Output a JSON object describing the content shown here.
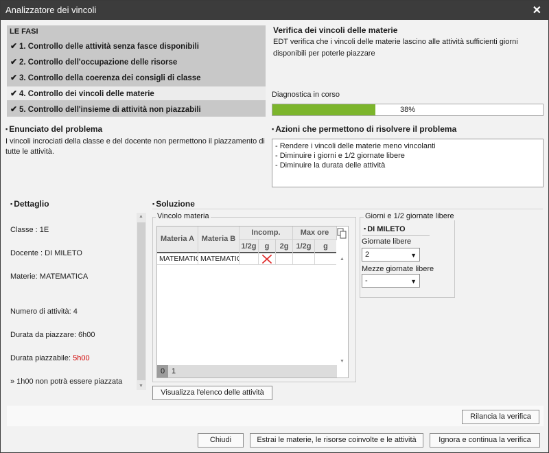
{
  "window": {
    "title": "Analizzatore dei vincoli"
  },
  "phases": {
    "header": "LE FASI",
    "items": [
      {
        "label": "1. Controllo delle attività senza fasce disponibili",
        "checked": true
      },
      {
        "label": "2. Controllo dell'occupazione delle risorse",
        "checked": true
      },
      {
        "label": "3. Controllo della coerenza dei consigli di classe",
        "checked": true
      },
      {
        "label": "4. Controllo dei vincoli delle materie",
        "checked": true
      },
      {
        "label": "5. Controllo dell'insieme di attività non piazzabili",
        "checked": true
      }
    ]
  },
  "verify": {
    "title": "Verifica dei vincoli delle materie",
    "description": "EDT verifica che i vincoli delle materie lascino alle attività sufficienti giorni disponibili per poterle piazzare",
    "diag_label": "Diagnostica in corso",
    "progress_text": "38%",
    "progress_value": 0.38,
    "progress_color": "#7cb52c"
  },
  "problem": {
    "title": "Enunciato del problema",
    "text": "I vincoli incrociati della classe e del docente non permettono il piazzamento di tutte le attività."
  },
  "actions": {
    "title": "Azioni che permettono di risolvere il problema",
    "items": [
      "- Rendere i vincoli delle materie meno vincolanti",
      "- Diminuire i giorni e 1/2 giornate libere",
      "- Diminuire la durata delle attività"
    ]
  },
  "detail": {
    "title": "Dettaglio",
    "classe": "Classe : 1E",
    "docente": "Docente : DI MILETO",
    "materie": "Materie: MATEMATICA",
    "num_attivita": "Numero di attività: 4",
    "durata_da_piazzare": "Durata da piazzare: 6h00",
    "durata_piazzabile_label": "Durata piazzabile: ",
    "durata_piazzabile_value": "5h00",
    "warning": "» 1h00 non potrà essere piazzata"
  },
  "solution": {
    "title": "Soluzione",
    "vincolo": {
      "group_label": "Vincolo materia",
      "headers": {
        "materia_a": "Materia A",
        "materia_b": "Materia B",
        "incomp": "Incomp.",
        "max_ore": "Max ore",
        "sub": [
          "1/2g",
          "g",
          "2g",
          "1/2g",
          "g"
        ]
      },
      "row": {
        "materia_a": "MATEMATICA",
        "materia_b": "MATEMATICA",
        "incomp_g_icon": "red-cross-icon"
      },
      "footer": {
        "selected": "0",
        "next": "1"
      }
    },
    "giorni": {
      "group_label": "Giorni e 1/2 giornate libere",
      "teacher": "DI MILETO",
      "giornate_label": "Giornate libere",
      "giornate_value": "2",
      "mezze_label": "Mezze giornate libere",
      "mezze_value": "-"
    },
    "list_button": "Visualizza l'elenco delle attività"
  },
  "buttons": {
    "rilancia": "Rilancia la verifica",
    "chiudi": "Chiudi",
    "estrai": "Estrai le materie, le risorse coinvolte e le attività",
    "ignora": "Ignora e continua la verifica"
  }
}
